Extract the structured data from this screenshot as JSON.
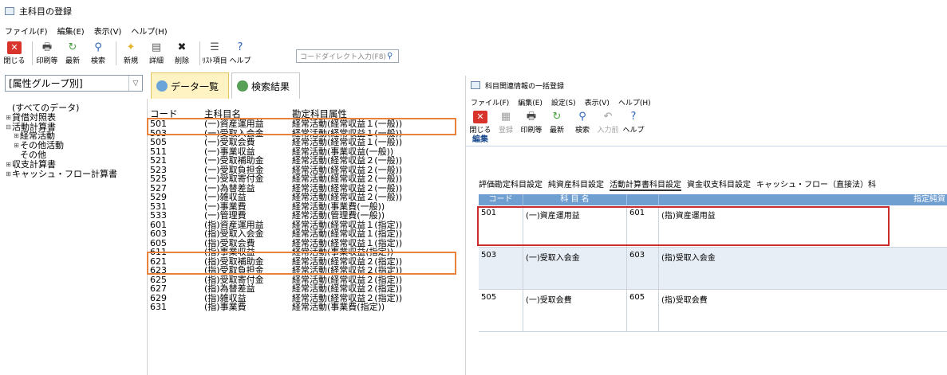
{
  "winA": {
    "title": "主科目の登録",
    "menu": [
      "ファイル(F)",
      "編集(E)",
      "表示(V)",
      "ヘルプ(H)"
    ],
    "toolbar": [
      {
        "label": "閉じる",
        "icon": "close-icon"
      },
      {
        "label": "印刷等",
        "icon": "print-icon"
      },
      {
        "label": "最新",
        "icon": "refresh-icon"
      },
      {
        "label": "検索",
        "icon": "search-icon"
      },
      {
        "label": "新規",
        "icon": "new-icon"
      },
      {
        "label": "詳細",
        "icon": "detail-icon"
      },
      {
        "label": "削除",
        "icon": "delete-icon"
      },
      {
        "label": "ﾘｽﾄ項目",
        "icon": "list-icon"
      },
      {
        "label": "ヘルプ",
        "icon": "help-icon"
      }
    ],
    "direct_input_placeholder": "コードダイレクト入力(F8)",
    "group_select": "[属性グループ別]",
    "tabs": [
      "データ一覧",
      "検索結果"
    ],
    "tree": [
      {
        "label": "(すべてのデータ)",
        "depth": 0,
        "twisty": ""
      },
      {
        "label": "貸借対照表",
        "depth": 0,
        "twisty": "⊞"
      },
      {
        "label": "活動計算書",
        "depth": 0,
        "twisty": "⊟"
      },
      {
        "label": "経常活動",
        "depth": 1,
        "twisty": "⊞"
      },
      {
        "label": "その他活動",
        "depth": 1,
        "twisty": "⊞"
      },
      {
        "label": "その他",
        "depth": 1,
        "twisty": ""
      },
      {
        "label": "収支計算書",
        "depth": 0,
        "twisty": "⊞"
      },
      {
        "label": "キャッシュ・フロー計算書",
        "depth": 0,
        "twisty": "⊞"
      }
    ],
    "grid": {
      "headers": [
        "コード",
        "主科目名",
        "勘定科目属性"
      ],
      "rows": [
        [
          "501",
          "(一)資産運用益",
          "経常活動(経常収益１(一般))"
        ],
        [
          "503",
          "(一)受取入会金",
          "経常活動(経常収益１(一般))"
        ],
        [
          "505",
          "(一)受取会費",
          "経常活動(経常収益１(一般))"
        ],
        [
          "511",
          "(一)事業収益",
          "経常活動(事業収益(一般))"
        ],
        [
          "521",
          "(一)受取補助金",
          "経常活動(経常収益２(一般))"
        ],
        [
          "523",
          "(一)受取負担金",
          "経常活動(経常収益２(一般))"
        ],
        [
          "525",
          "(一)受取寄付金",
          "経常活動(経常収益２(一般))"
        ],
        [
          "527",
          "(一)為替差益",
          "経常活動(経常収益２(一般))"
        ],
        [
          "529",
          "(一)雑収益",
          "経常活動(経常収益２(一般))"
        ],
        [
          "531",
          "(一)事業費",
          "経常活動(事業費(一般))"
        ],
        [
          "533",
          "(一)管理費",
          "経常活動(管理費(一般))"
        ],
        [
          "601",
          "(指)資産運用益",
          "経常活動(経常収益１(指定))"
        ],
        [
          "603",
          "(指)受取入会金",
          "経常活動(経常収益１(指定))"
        ],
        [
          "605",
          "(指)受取会費",
          "経常活動(経常収益１(指定))"
        ],
        [
          "611",
          "(指)事業収益",
          "経常活動(事業収益(指定))"
        ],
        [
          "621",
          "(指)受取補助金",
          "経常活動(経常収益２(指定))"
        ],
        [
          "623",
          "(指)受取負担金",
          "経常活動(経常収益２(指定))"
        ],
        [
          "625",
          "(指)受取寄付金",
          "経常活動(経常収益２(指定))"
        ],
        [
          "627",
          "(指)為替差益",
          "経常活動(経常収益２(指定))"
        ],
        [
          "629",
          "(指)雑収益",
          "経常活動(経常収益２(指定))"
        ],
        [
          "631",
          "(指)事業費",
          "経常活動(事業費(指定))"
        ]
      ]
    }
  },
  "winB": {
    "title": "科目関連情報の一括登録",
    "menu": [
      "ファイル(F)",
      "編集(E)",
      "設定(S)",
      "表示(V)",
      "ヘルプ(H)"
    ],
    "toolbar": [
      {
        "label": "閉じる",
        "icon": "close-icon",
        "enabled": true
      },
      {
        "label": "登録",
        "icon": "register-icon",
        "enabled": false
      },
      {
        "label": "印刷等",
        "icon": "print-icon",
        "enabled": true
      },
      {
        "label": "最新",
        "icon": "refresh-icon",
        "enabled": true
      },
      {
        "label": "検索",
        "icon": "search-icon",
        "enabled": true
      },
      {
        "label": "入力前",
        "icon": "undo-icon",
        "enabled": false
      },
      {
        "label": "ヘルプ",
        "icon": "help-icon",
        "enabled": true
      }
    ],
    "edit_label": "編集",
    "subtabs": [
      "評価勘定科目設定",
      "純資産科目設定",
      "活動計算書科目設定",
      "資金収支科目設定",
      "キャッシュ・フロー（直接法）科"
    ],
    "selected_subtab": 2,
    "grid": {
      "headers": [
        "コード",
        "科 目 名",
        "",
        "指定純資"
      ],
      "rows": [
        [
          "501",
          "(一)資産運用益",
          "601",
          "(指)資産運用益"
        ],
        [
          "503",
          "(一)受取入会金",
          "603",
          "(指)受取入会金"
        ],
        [
          "505",
          "(一)受取会費",
          "605",
          "(指)受取会費"
        ]
      ]
    }
  },
  "colors": {
    "orange_highlight": "#e8823c",
    "red_highlight": "#cc2b2b",
    "grid_header_blue": "#6f9fd1",
    "active_tab": "#fff3c4"
  }
}
